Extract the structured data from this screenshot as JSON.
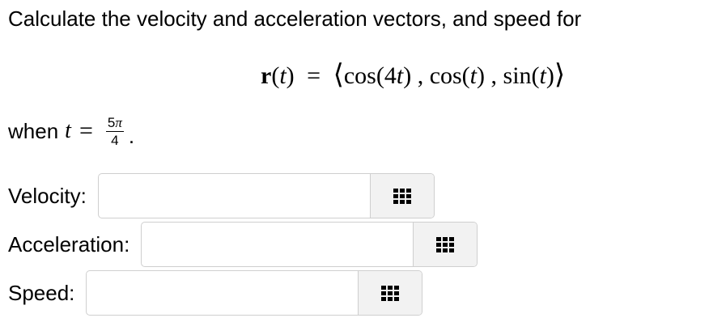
{
  "prompt": {
    "text": "Calculate the velocity and acceleration vectors, and speed for"
  },
  "equation": {
    "lhs_r": "r",
    "lhs_open": "(",
    "lhs_t": "t",
    "lhs_close": ")",
    "equals": "=",
    "langle": "⟨",
    "f1": "cos(4",
    "f1_t": "t",
    "f1_end": ")",
    "sep1": " , ",
    "f2": "cos(",
    "f2_t": "t",
    "f2_end": ")",
    "sep2": " , ",
    "f3": "sin(",
    "f3_t": "t",
    "f3_end": ")",
    "rangle": "⟩"
  },
  "when": {
    "prefix": "when",
    "variable": "t",
    "equals": "=",
    "numerator_num": "5",
    "numerator_pi": "π",
    "denominator": "4",
    "period": "."
  },
  "fields": [
    {
      "label": "Velocity:",
      "value": "",
      "icon": "grid-keypad-icon"
    },
    {
      "label": "Acceleration:",
      "value": "",
      "icon": "grid-keypad-icon"
    },
    {
      "label": "Speed:",
      "value": "",
      "icon": "grid-keypad-icon"
    }
  ]
}
